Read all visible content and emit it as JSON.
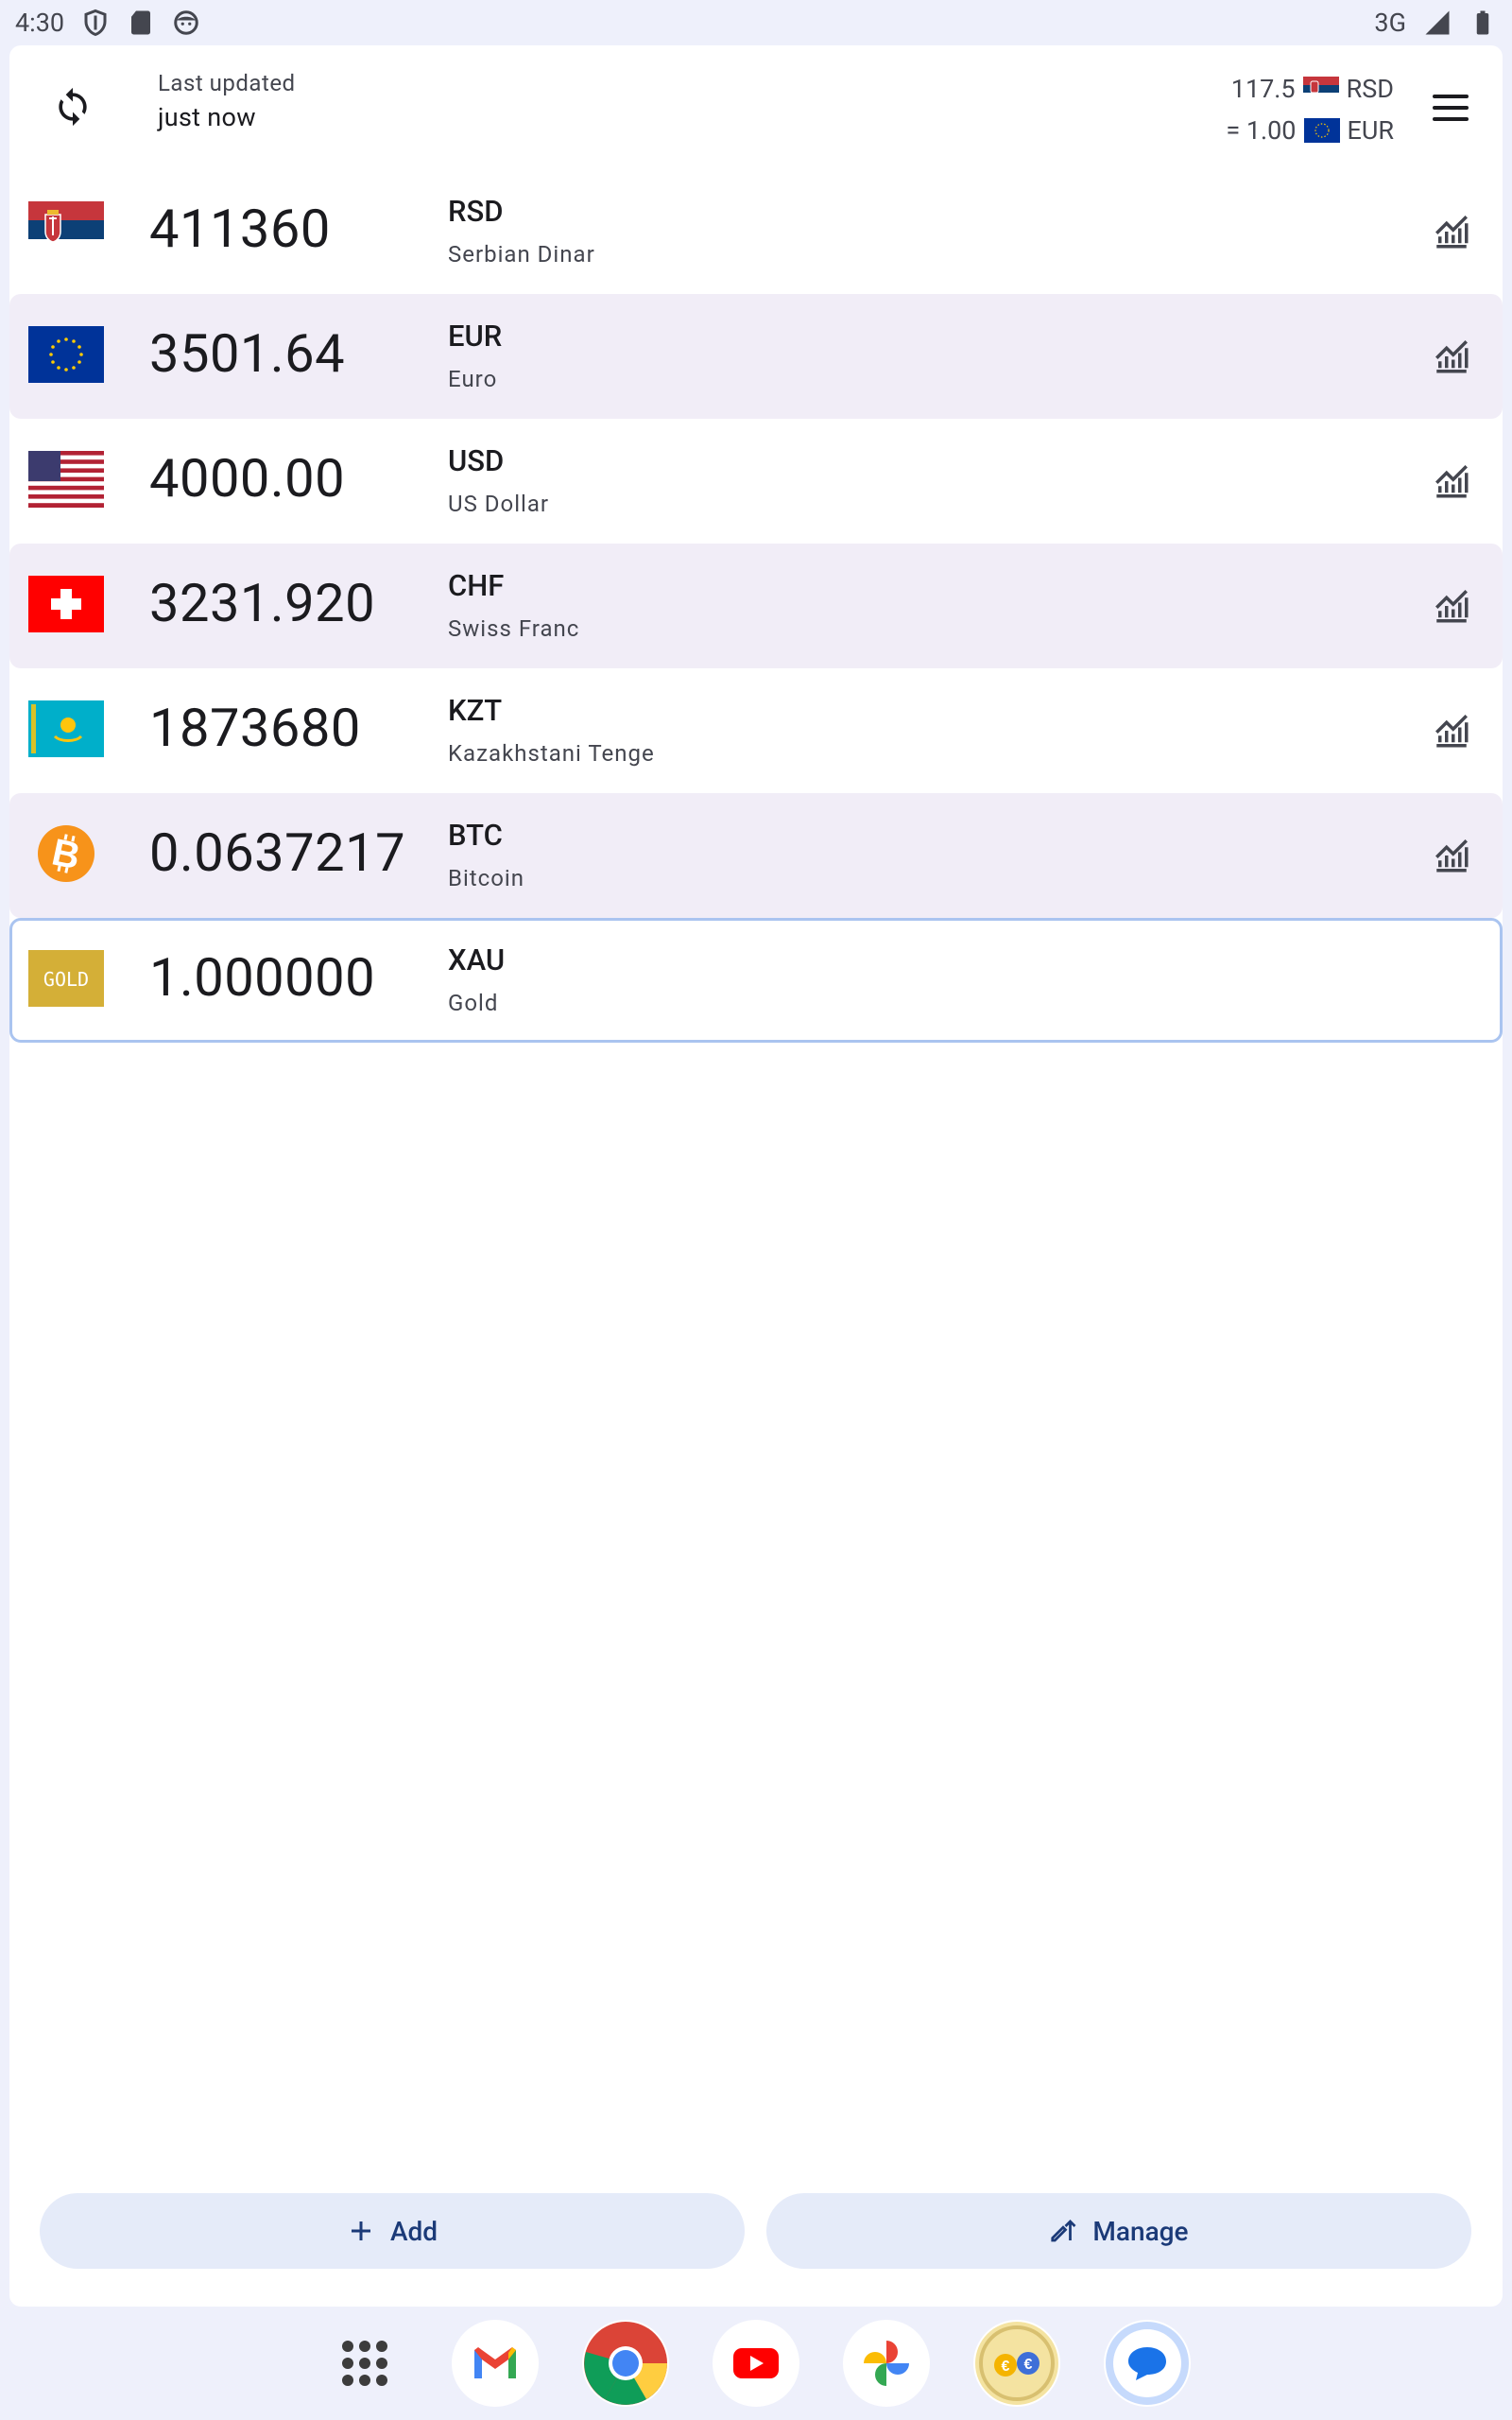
{
  "status_bar": {
    "time": "4:30",
    "network": "3G",
    "icons": [
      "shield-icon",
      "sd-card-icon",
      "face-icon",
      "signal-icon",
      "battery-icon"
    ]
  },
  "header": {
    "last_updated_label": "Last updated",
    "last_updated_value": "just now",
    "rate_from_value": "117.5",
    "rate_from_code": "RSD",
    "rate_to_value": "= 1.00",
    "rate_to_code": "EUR"
  },
  "currencies": [
    {
      "amount": "411360",
      "code": "RSD",
      "name": "Serbian Dinar",
      "flag": "serbia-flag"
    },
    {
      "amount": "3501.64",
      "code": "EUR",
      "name": "Euro",
      "flag": "eu-flag"
    },
    {
      "amount": "4000.00",
      "code": "USD",
      "name": "US Dollar",
      "flag": "us-flag"
    },
    {
      "amount": "3231.920",
      "code": "CHF",
      "name": "Swiss Franc",
      "flag": "swiss-flag"
    },
    {
      "amount": "1873680",
      "code": "KZT",
      "name": "Kazakhstani Tenge",
      "flag": "kazakhstan-flag"
    },
    {
      "amount": "0.0637217",
      "code": "BTC",
      "name": "Bitcoin",
      "flag": "bitcoin-icon"
    },
    {
      "amount": "1.000000",
      "code": "XAU",
      "name": "Gold",
      "flag": "gold-icon",
      "gold_text": "GOLD"
    }
  ],
  "actions": {
    "add_label": "Add",
    "manage_label": "Manage"
  },
  "dock": [
    "app-drawer-icon",
    "gmail-icon",
    "chrome-icon",
    "youtube-icon",
    "photos-icon",
    "currency-converter-icon",
    "messages-icon"
  ],
  "colors": {
    "accent": "#1b3a78",
    "row_alt": "#f1edf7",
    "selected_border": "#aac4f0",
    "button_bg": "#e5ebf9"
  }
}
